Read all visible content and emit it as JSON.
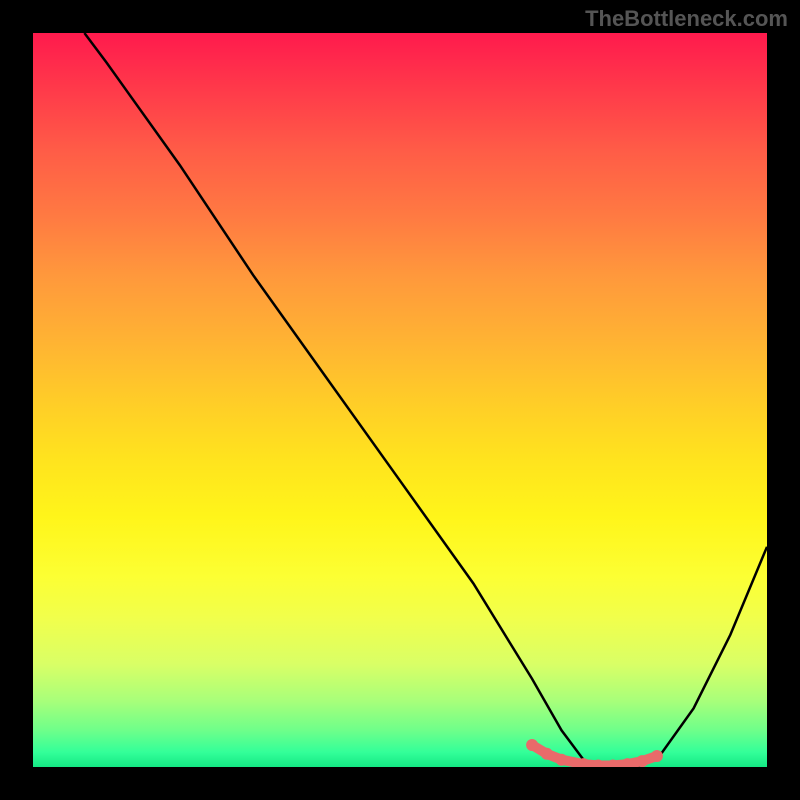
{
  "watermark": "TheBottleneck.com",
  "chart_data": {
    "type": "line",
    "title": "",
    "xlabel": "",
    "ylabel": "",
    "xlim": [
      0,
      100
    ],
    "ylim": [
      0,
      100
    ],
    "series": [
      {
        "name": "curve",
        "x": [
          7,
          10,
          20,
          30,
          40,
          50,
          60,
          68,
          72,
          75,
          78,
          82,
          85,
          90,
          95,
          100
        ],
        "values": [
          100,
          96,
          82,
          67,
          53,
          39,
          25,
          12,
          5,
          1,
          0,
          0,
          1,
          8,
          18,
          30
        ]
      }
    ],
    "markers": {
      "name": "highlighted-points",
      "color": "#e96a6a",
      "x": [
        68,
        70,
        72,
        75,
        77,
        79,
        81,
        83,
        85
      ],
      "values": [
        3.0,
        1.8,
        1.0,
        0.4,
        0.2,
        0.2,
        0.4,
        0.8,
        1.5
      ]
    },
    "gradient_stops": [
      {
        "pos": 0,
        "color": "#ff1a4d"
      },
      {
        "pos": 50,
        "color": "#ffcc28"
      },
      {
        "pos": 80,
        "color": "#f0ff4d"
      },
      {
        "pos": 100,
        "color": "#14e884"
      }
    ]
  }
}
